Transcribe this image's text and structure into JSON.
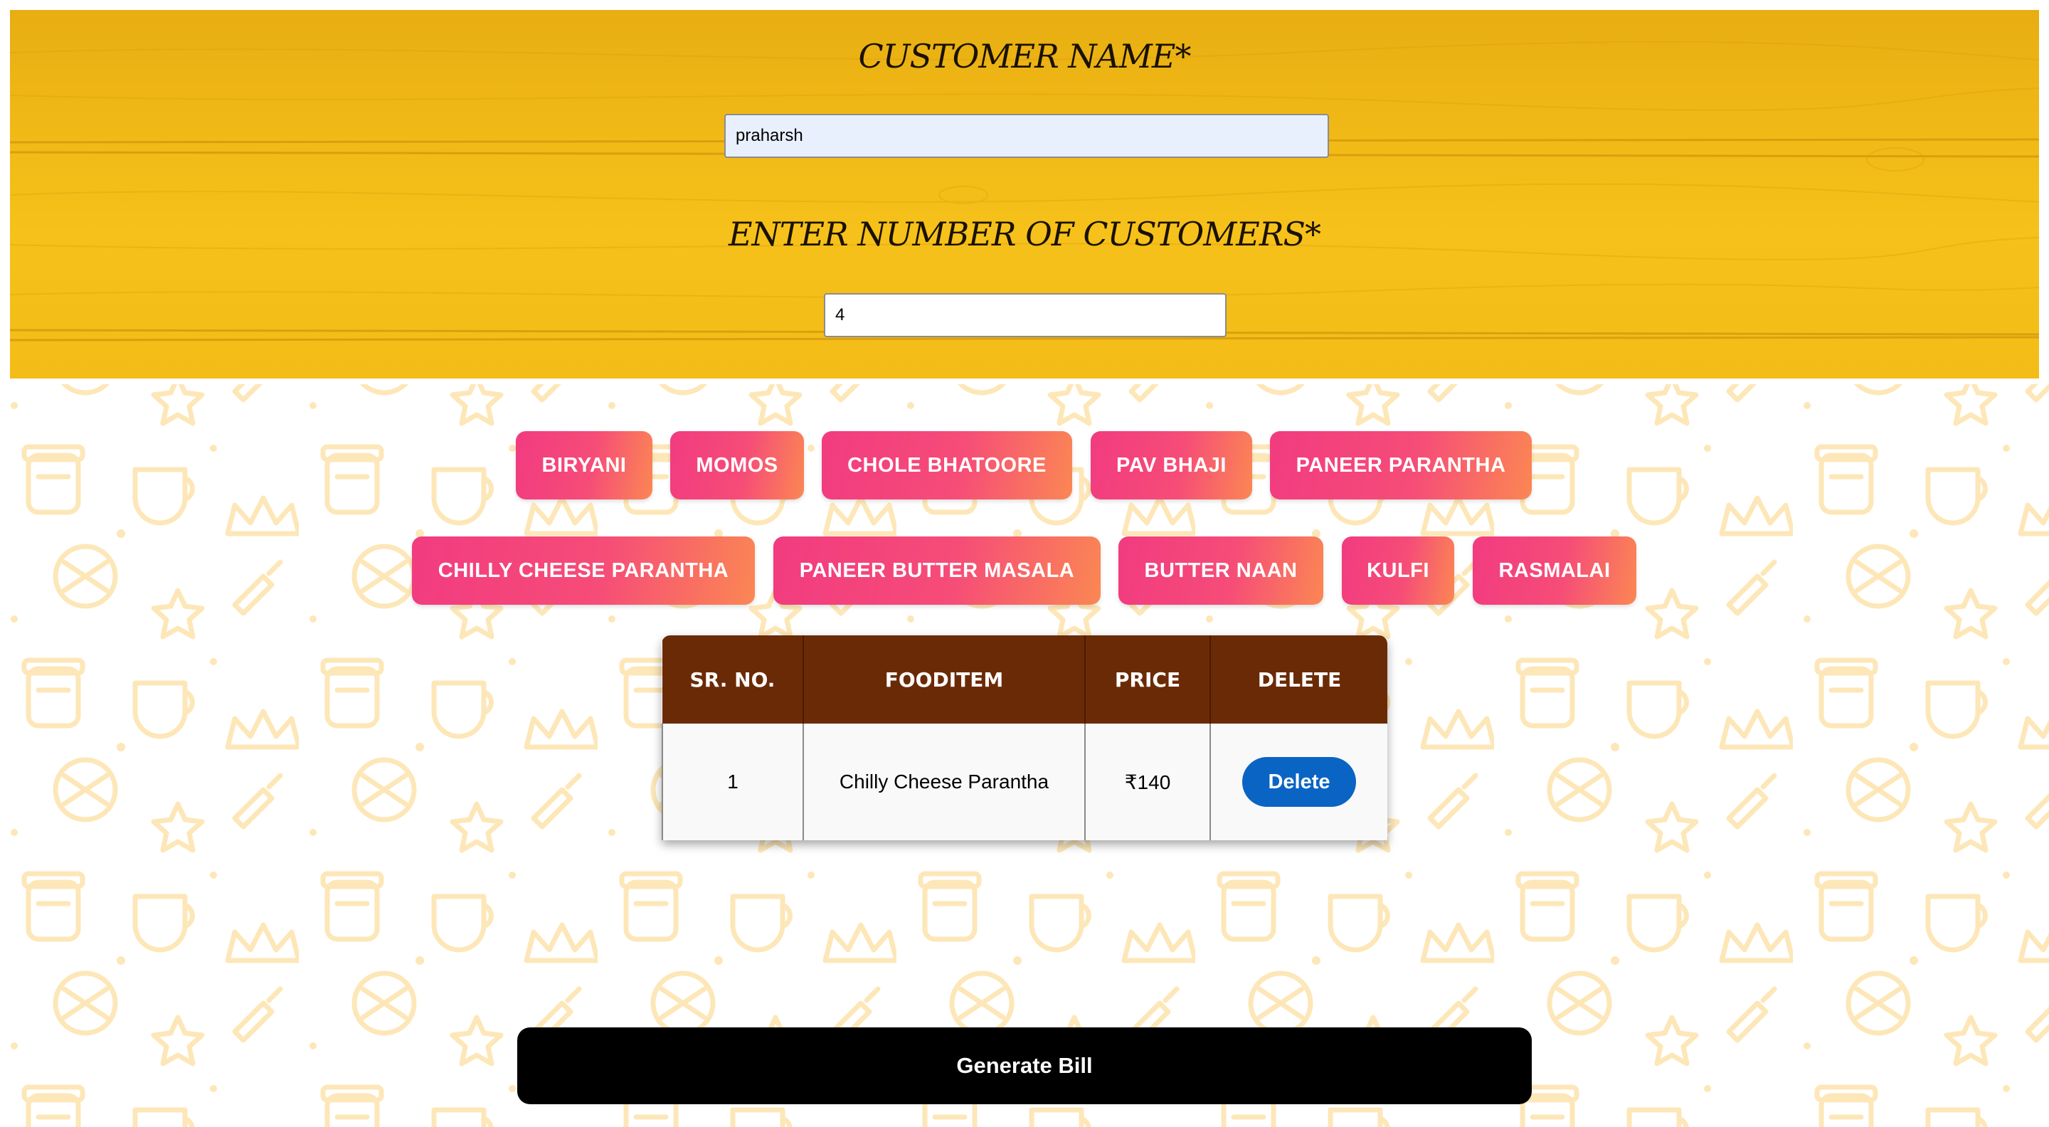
{
  "colors": {
    "header_wood": "#f3bc17",
    "food_button_start": "#f23b80",
    "food_button_end": "#fb8753",
    "table_header": "#6b2a06",
    "delete_button": "#0a64c4",
    "generate_button": "#000000",
    "doodle_pattern": "#fde7b8"
  },
  "header": {
    "customer_name_label": "CUSTOMER NAME*",
    "customer_name_value": "praharsh",
    "customer_count_label": "ENTER NUMBER OF CUSTOMERS*",
    "customer_count_value": "4"
  },
  "menu": {
    "row1": [
      "BIRYANI",
      "MOMOS",
      "CHOLE BHATOORE",
      "PAV BHAJI",
      "PANEER PARANTHA"
    ],
    "row2": [
      "CHILLY CHEESE PARANTHA",
      "PANEER BUTTER MASALA",
      "BUTTER NAAN",
      "KULFI",
      "RASMALAI"
    ]
  },
  "order_table": {
    "columns": [
      "SR. NO.",
      "FOODITEM",
      "PRICE",
      "DELETE"
    ],
    "rows": [
      {
        "sr_no": "1",
        "food_item": "Chilly Cheese Parantha",
        "price": "₹140",
        "delete_label": "Delete"
      }
    ]
  },
  "actions": {
    "generate_bill_label": "Generate Bill"
  },
  "icons": {
    "background_pattern": "food-doodle-pattern"
  }
}
